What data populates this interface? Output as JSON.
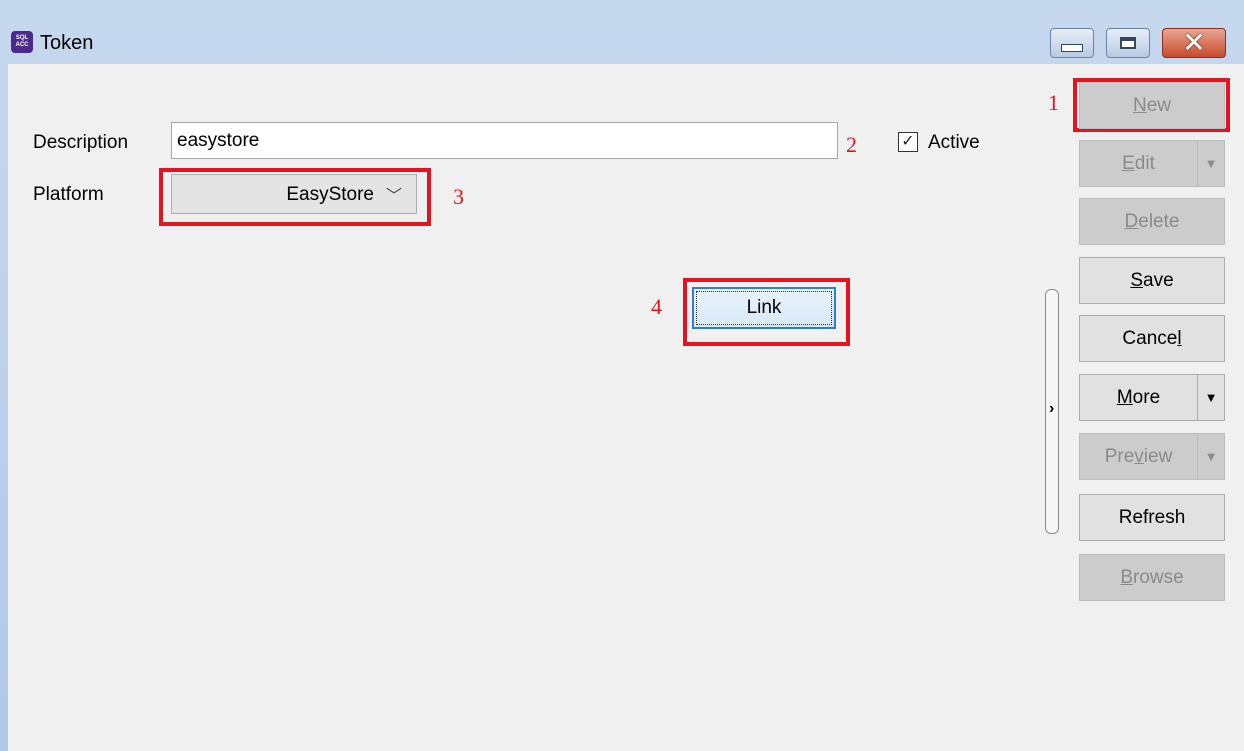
{
  "window": {
    "title": "Token",
    "app_icon_text": "SQL ACC"
  },
  "form": {
    "description_label": "Description",
    "description_value": "easystore",
    "platform_label": "Platform",
    "platform_value": "EasyStore",
    "active_label": "Active",
    "active_checked": true,
    "link_label": "Link"
  },
  "annotations": {
    "n1": "1",
    "n2": "2",
    "n3": "3",
    "n4": "4",
    "color": "#e3141f"
  },
  "side_buttons": {
    "new_pre": "",
    "new_u": "N",
    "new_post": "ew",
    "edit_pre": "",
    "edit_u": "E",
    "edit_post": "dit",
    "delete_pre": "",
    "delete_u": "D",
    "delete_post": "elete",
    "save_pre": "",
    "save_u": "S",
    "save_post": "ave",
    "cancel_pre": "Cance",
    "cancel_u": "l",
    "cancel_post": "",
    "more_pre": "",
    "more_u": "M",
    "more_post": "ore",
    "preview_pre": "Pre",
    "preview_u": "v",
    "preview_post": "iew",
    "refresh_label": "Refresh",
    "browse_pre": "",
    "browse_u": "B",
    "browse_post": "rowse"
  },
  "icons": {
    "dropdown": "chevron-down-icon",
    "split_arrow": "triangle-down-icon",
    "splitter": "chevron-right-icon",
    "checkbox": "checkmark-icon"
  }
}
